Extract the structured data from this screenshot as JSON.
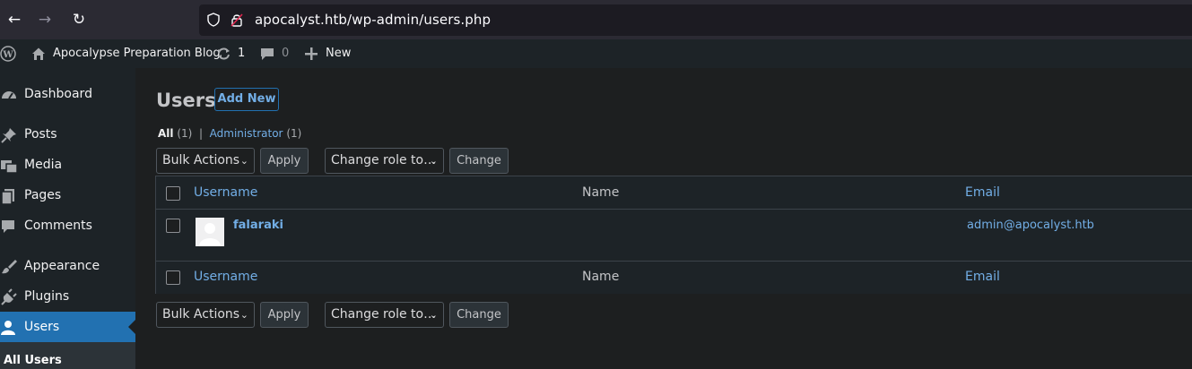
{
  "browser": {
    "url": "apocalyst.htb/wp-admin/users.php"
  },
  "adminbar": {
    "site_name": "Apocalypse Preparation Blog",
    "updates_count": "1",
    "comments_count": "0",
    "new_label": "New"
  },
  "sidebar": {
    "items": [
      {
        "label": "Dashboard",
        "icon": "dashboard-icon"
      },
      {
        "label": "Posts",
        "icon": "pin-icon"
      },
      {
        "label": "Media",
        "icon": "media-icon"
      },
      {
        "label": "Pages",
        "icon": "pages-icon"
      },
      {
        "label": "Comments",
        "icon": "comment-icon"
      },
      {
        "label": "Appearance",
        "icon": "brush-icon"
      },
      {
        "label": "Plugins",
        "icon": "plug-icon"
      },
      {
        "label": "Users",
        "icon": "user-icon"
      }
    ],
    "submenu_label": "All Users"
  },
  "page": {
    "title": "Users",
    "add_new": "Add New"
  },
  "filters": {
    "all_label": "All",
    "all_count": "(1)",
    "separator": "|",
    "admin_label": "Administrator",
    "admin_count": "(1)"
  },
  "toolbar": {
    "bulk_actions": "Bulk Actions",
    "apply": "Apply",
    "change_role": "Change role to…",
    "change": "Change"
  },
  "table": {
    "columns": [
      "Username",
      "Name",
      "Email"
    ],
    "rows": [
      {
        "username": "falaraki",
        "name": "",
        "email": "admin@apocalyst.htb"
      }
    ]
  },
  "colors": {
    "accent": "#2271b1",
    "link": "#72aee6"
  }
}
